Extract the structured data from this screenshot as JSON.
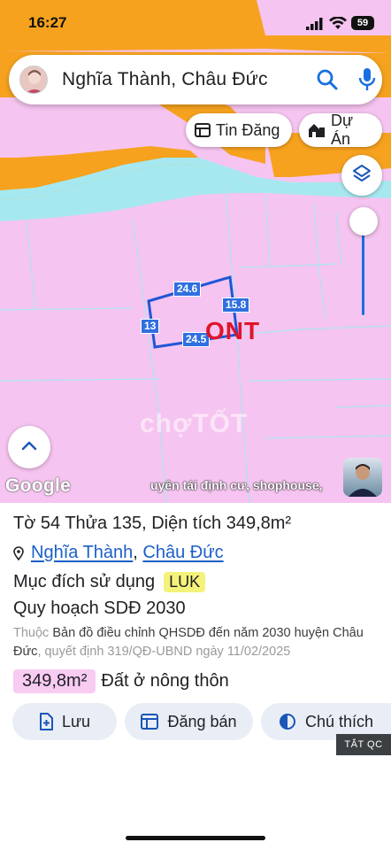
{
  "status": {
    "time": "16:27",
    "battery": "59"
  },
  "search": {
    "query": "Nghĩa Thành, Châu Đức"
  },
  "chips": {
    "tin_dang": "Tin Đăng",
    "du_an": "Dự Án"
  },
  "map": {
    "parcel_edges": [
      "24.6",
      "15.8",
      "13",
      "24.5"
    ],
    "zone_label": "ONT",
    "watermark": "chợTỐT",
    "google_logo": "Google",
    "ticker": "uyên tái định cư, shophouse,"
  },
  "info": {
    "title_parts": [
      "Tờ",
      "54",
      "Thửa",
      "135,",
      "Diện tích",
      "349,8m²"
    ],
    "title": "Tờ 54 Thửa 135, Diện tích 349,8m²",
    "ward": "Nghĩa Thành",
    "district": "Châu Đức",
    "purpose_label": "Mục đích sử dụng",
    "purpose_code": "LUK",
    "plan_label": "Quy hoạch SDĐ 2030",
    "source_prefix": "Thuộc",
    "source_map": "Bản đồ điều chỉnh QHSDĐ đến năm 2030 huyện Châu Đức",
    "source_decision": ", quyết định 319/QĐ-UBND ngày 11/02/2025",
    "area_value": "349,8m²",
    "area_type": "Đất ở nông thôn"
  },
  "actions": {
    "save": "Lưu",
    "post": "Đăng bán",
    "legend": "Chú thích",
    "ad_off": "TẮT QC"
  },
  "colors": {
    "map_pink": "#f6c4f0",
    "water": "#a6e8ef",
    "orange": "#f6a21e",
    "link": "#1a5fc8",
    "accent_blue": "#1a6fe0"
  }
}
